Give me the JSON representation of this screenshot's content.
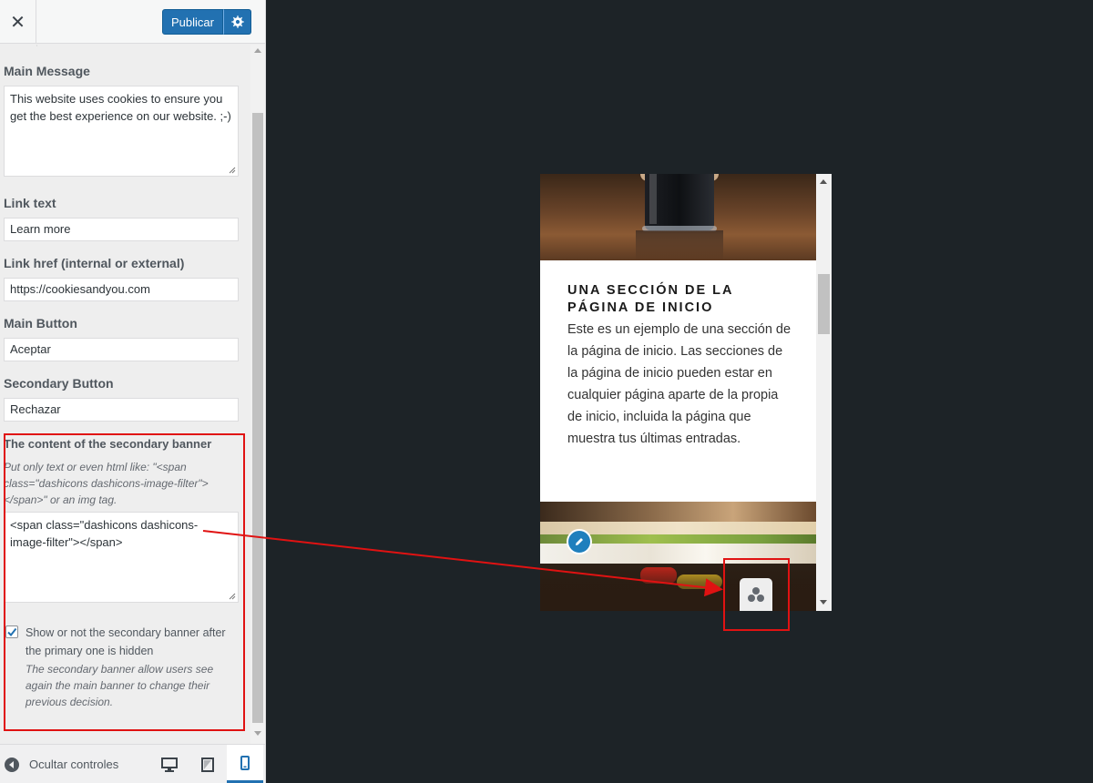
{
  "topbar": {
    "close_icon": "close-icon",
    "publish_label": "Publicar",
    "settings_icon": "gear-icon",
    "accent_color": "#2271b1"
  },
  "fields": {
    "main_message": {
      "label": "Main Message",
      "value": "This website uses cookies to ensure you get the best experience on our website. ;-)"
    },
    "link_text": {
      "label": "Link text",
      "value": "Learn more"
    },
    "link_href": {
      "label": "Link href (internal or external)",
      "value": "https://cookiesandyou.com"
    },
    "main_button": {
      "label": "Main Button",
      "value": "Aceptar"
    },
    "secondary_button": {
      "label": "Secondary Button",
      "value": "Rechazar"
    },
    "secondary_banner": {
      "label": "The content of the secondary banner",
      "description": "Put only text or even html like: \"<span class=\"dashicons dashicons-image-filter\"></span>\" or an img tag.",
      "value": "<span class=\"dashicons dashicons-image-filter\"></span>"
    },
    "show_secondary": {
      "checked": true,
      "label": "Show or not the secondary banner after the primary one is hidden",
      "description": "The secondary banner allow users see again the main banner to change their previous decision."
    }
  },
  "footer": {
    "hide_controls_label": "Ocultar controles",
    "devices": [
      {
        "name": "desktop",
        "icon": "desktop-icon",
        "active": false
      },
      {
        "name": "tablet",
        "icon": "tablet-icon",
        "active": false
      },
      {
        "name": "mobile",
        "icon": "mobile-icon",
        "active": true
      }
    ]
  },
  "preview": {
    "section_title": "UNA SECCIÓN DE LA PÁGINA DE INICIO",
    "section_body": "Este es un ejemplo de una sección de la página de inicio. Las secciones de la página de inicio pueden estar en cualquier página aparte de la propia de inicio, incluida la página que muestra tus últimas entradas.",
    "edit_icon": "pencil-icon",
    "banner_icon": "image-filter-icon"
  },
  "annotation": {
    "color": "#e01212"
  }
}
